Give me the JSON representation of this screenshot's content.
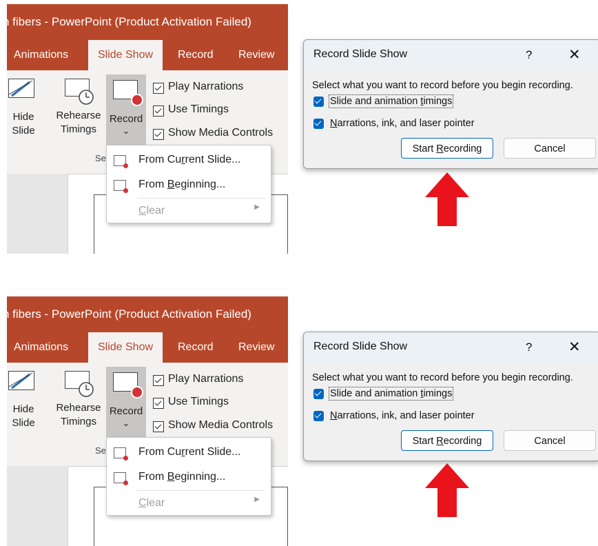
{
  "panels": [
    {
      "app": {
        "title": "n fibers  -  PowerPoint (Product Activation Failed)",
        "tabs": [
          "Animations",
          "Slide Show",
          "Record",
          "Review"
        ],
        "active_tab": "Slide Show",
        "hide_slide": [
          "Hide",
          "Slide"
        ],
        "rehearse": [
          "Rehearse",
          "Timings"
        ],
        "record": "Record",
        "record_chevron": "⌄",
        "options": [
          "Play Narrations",
          "Use Timings",
          "Show Media Controls"
        ],
        "group_label_fragment": "Se",
        "menu": {
          "from_current": [
            "From Cu",
            "r",
            "rent Slide..."
          ],
          "from_beginning": [
            "From ",
            "B",
            "eginning..."
          ],
          "clear": [
            "",
            "C",
            "lear"
          ]
        }
      },
      "dialog": {
        "title": "Record Slide Show",
        "help": "?",
        "close": "✕",
        "prompt": "Select what you want to record before you begin recording.",
        "opt1": [
          "Slide and animation ",
          "t",
          "imings"
        ],
        "opt2": [
          "",
          "N",
          "arrations, ink, and laser pointer"
        ],
        "start": [
          "Start ",
          "R",
          "ecording"
        ],
        "cancel": "Cancel"
      }
    },
    {
      "app": {
        "title": "n fibers  -  PowerPoint (Product Activation Failed)",
        "tabs": [
          "Animations",
          "Slide Show",
          "Record",
          "Review"
        ],
        "active_tab": "Slide Show",
        "hide_slide": [
          "Hide",
          "Slide"
        ],
        "rehearse": [
          "Rehearse",
          "Timings"
        ],
        "record": "Record",
        "record_chevron": "⌄",
        "options": [
          "Play Narrations",
          "Use Timings",
          "Show Media Controls"
        ],
        "group_label_fragment": "Se",
        "menu": {
          "from_current": [
            "From Cu",
            "r",
            "rent Slide..."
          ],
          "from_beginning": [
            "From ",
            "B",
            "eginning..."
          ],
          "clear": [
            "",
            "C",
            "lear"
          ]
        }
      },
      "dialog": {
        "title": "Record Slide Show",
        "help": "?",
        "close": "✕",
        "prompt": "Select what you want to record before you begin recording.",
        "opt1": [
          "Slide and animation ",
          "t",
          "imings"
        ],
        "opt2": [
          "",
          "N",
          "arrations, ink, and laser pointer"
        ],
        "start": [
          "Start ",
          "R",
          "ecording"
        ],
        "cancel": "Cancel"
      }
    }
  ],
  "colors": {
    "ribbon_brand": "#b7472a",
    "dialog_accent": "#0067c0",
    "arrow": "#e8131b"
  }
}
